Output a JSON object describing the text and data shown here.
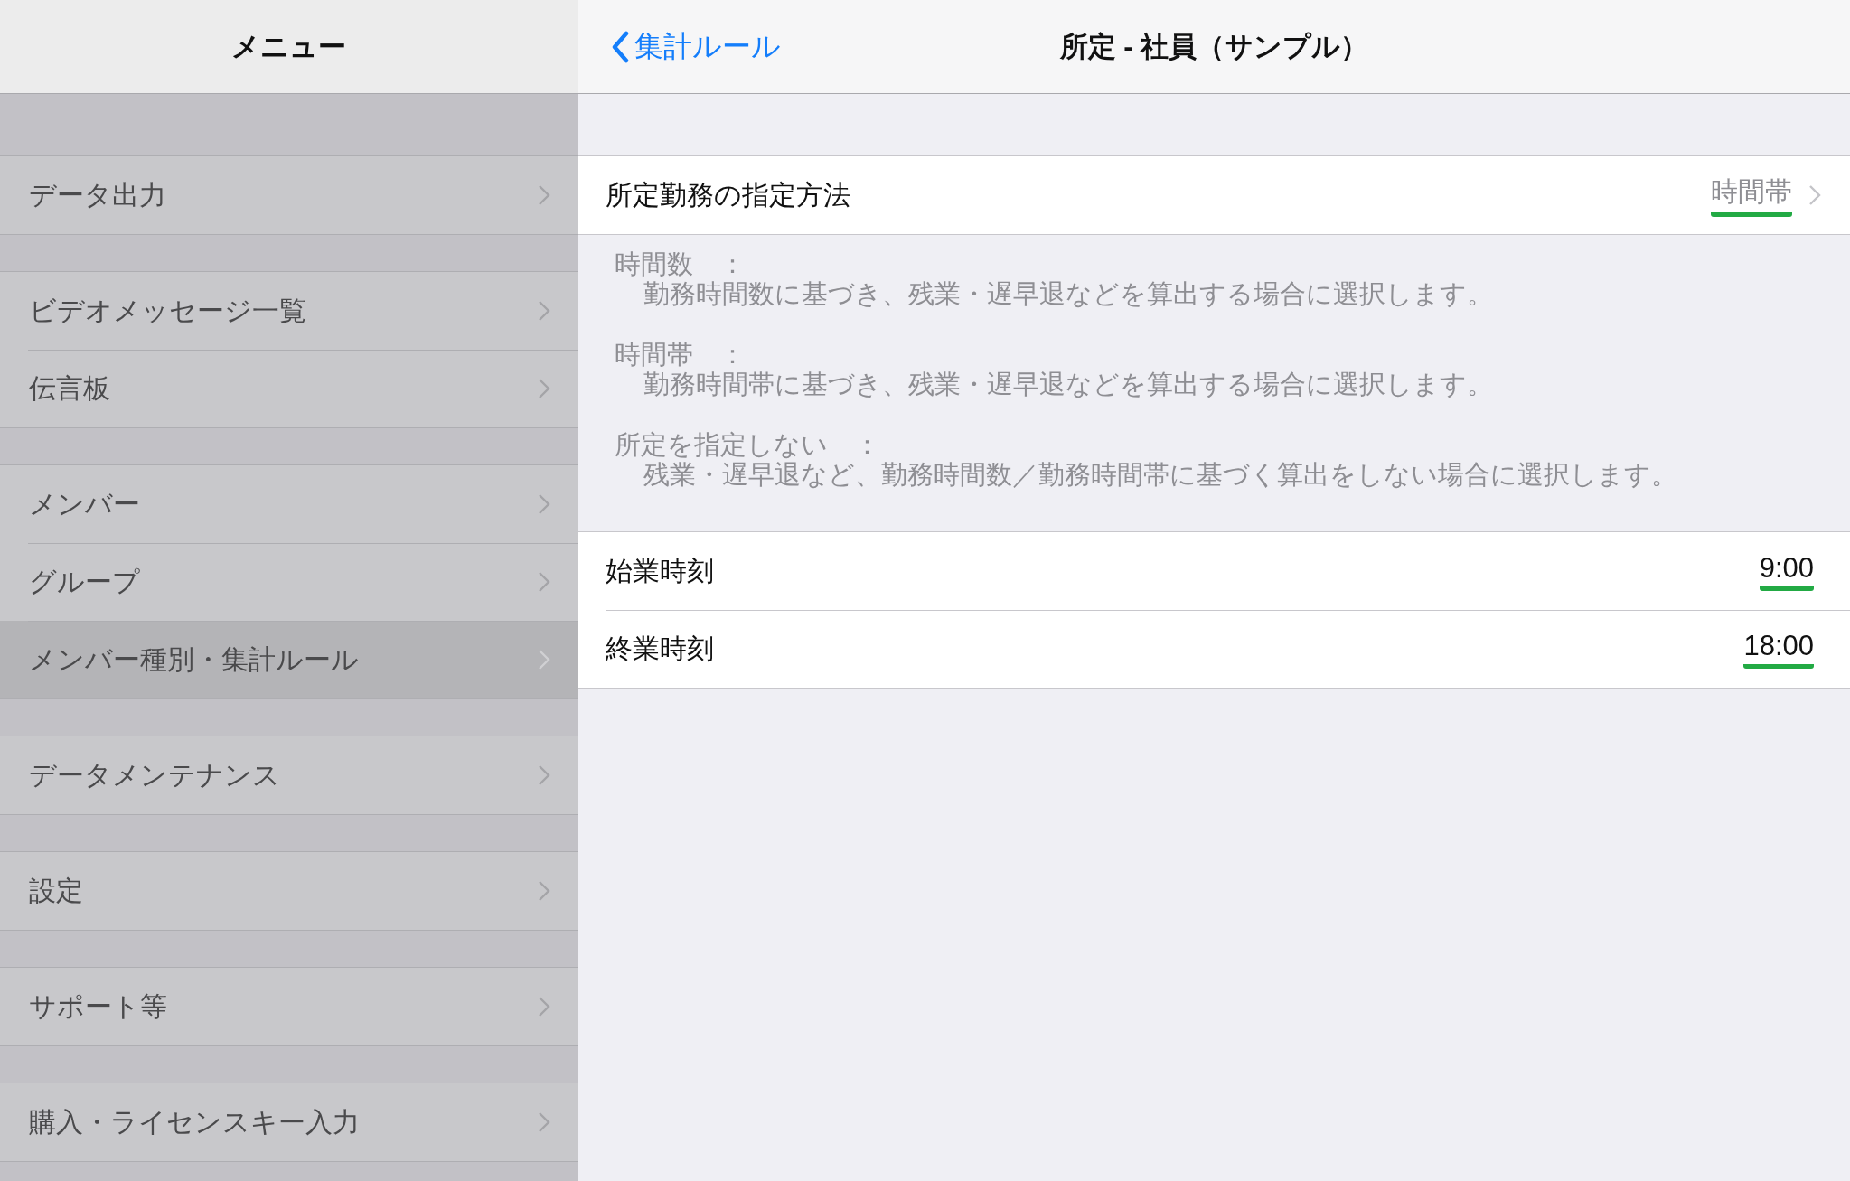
{
  "sidebar": {
    "title": "メニュー",
    "groups": [
      {
        "items": [
          {
            "label": "データ出力",
            "selected": false
          }
        ]
      },
      {
        "items": [
          {
            "label": "ビデオメッセージ一覧",
            "selected": false
          },
          {
            "label": "伝言板",
            "selected": false
          }
        ]
      },
      {
        "items": [
          {
            "label": "メンバー",
            "selected": false
          },
          {
            "label": "グループ",
            "selected": false
          },
          {
            "label": "メンバー種別・集計ルール",
            "selected": true
          }
        ]
      },
      {
        "items": [
          {
            "label": "データメンテナンス",
            "selected": false
          }
        ]
      },
      {
        "items": [
          {
            "label": "設定",
            "selected": false
          }
        ]
      },
      {
        "items": [
          {
            "label": "サポート等",
            "selected": false
          }
        ]
      },
      {
        "items": [
          {
            "label": "購入・ライセンスキー入力",
            "selected": false
          }
        ]
      }
    ]
  },
  "detail": {
    "back": "集計ルール",
    "title": "所定 - 社員（サンプル）",
    "method_row": {
      "label": "所定勤務の指定方法",
      "value": "時間帯",
      "underlined": true
    },
    "notes": [
      {
        "term": "時間数　：",
        "text": "勤務時間数に基づき、残業・遅早退などを算出する場合に選択します。"
      },
      {
        "term": "時間帯　：",
        "text": "勤務時間帯に基づき、残業・遅早退などを算出する場合に選択します。"
      },
      {
        "term": "所定を指定しない　：",
        "text": "残業・遅早退など、勤務時間数／勤務時間帯に基づく算出をしない場合に選択します。"
      }
    ],
    "time_rows": [
      {
        "label": "始業時刻",
        "value": "9:00",
        "underlined": true
      },
      {
        "label": "終業時刻",
        "value": "18:00",
        "underlined": true
      }
    ]
  }
}
